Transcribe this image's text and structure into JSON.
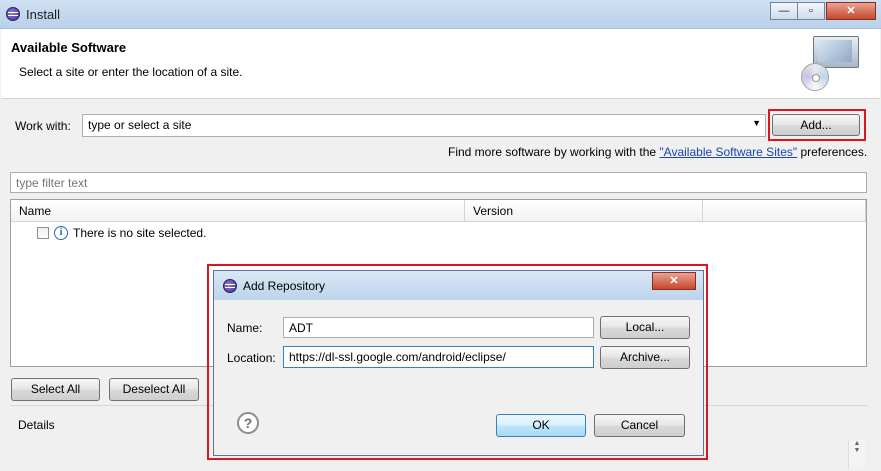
{
  "window": {
    "title": "Install",
    "minimize": "—",
    "maximize": "▫",
    "close": "✕"
  },
  "header": {
    "title": "Available Software",
    "subtitle": "Select a site or enter the location of a site."
  },
  "work_with": {
    "label": "Work with:",
    "value": "type or select a site",
    "add_button": "Add...",
    "find_more_prefix": "Find more software by working with the ",
    "find_more_link": "\"Available Software Sites\"",
    "find_more_suffix": " preferences."
  },
  "filter": {
    "placeholder": "type filter text"
  },
  "table": {
    "columns": [
      "Name",
      "Version"
    ],
    "rows": [
      {
        "name": "There is no site selected."
      }
    ]
  },
  "buttons": {
    "select_all": "Select All",
    "deselect_all": "Deselect All"
  },
  "details": {
    "label": "Details"
  },
  "dialog": {
    "title": "Add Repository",
    "close": "✕",
    "name_label": "Name:",
    "name_value": "ADT",
    "location_label": "Location:",
    "location_value": "https://dl-ssl.google.com/android/eclipse/",
    "local_button": "Local...",
    "archive_button": "Archive...",
    "ok_button": "OK",
    "cancel_button": "Cancel",
    "help_icon": "?"
  },
  "colors": {
    "highlight_red": "#d9171e",
    "link_blue": "#1a46a8"
  }
}
